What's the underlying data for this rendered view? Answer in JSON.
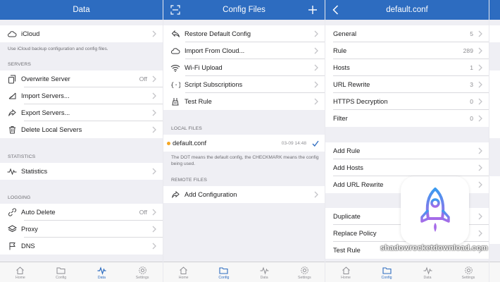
{
  "colors": {
    "nav": "#2d6cc0",
    "accent": "#2d6cc0",
    "dot": "#f5a623"
  },
  "data_panel": {
    "title": "Data",
    "icloud_label": "iCloud",
    "icloud_note": "Use iCloud backup configuration and config files.",
    "servers_header": "SERVERS",
    "overwrite_label": "Overwrite Server",
    "overwrite_value": "Off",
    "import_label": "Import Servers...",
    "export_label": "Export Servers...",
    "delete_label": "Delete Local Servers",
    "statistics_header": "STATISTICS",
    "statistics_label": "Statistics",
    "logging_header": "LOGGING",
    "auto_delete_label": "Auto Delete",
    "auto_delete_value": "Off",
    "proxy_label": "Proxy",
    "dns_label": "DNS"
  },
  "config_panel": {
    "title": "Config Files",
    "restore_label": "Restore Default Config",
    "import_cloud_label": "Import From Cloud...",
    "wifi_upload_label": "Wi-Fi Upload",
    "script_subs_label": "Script Subscriptions",
    "test_rule_label": "Test Rule",
    "local_header": "LOCAL FILES",
    "file_name": "default.conf",
    "file_date": "03-09 14:48",
    "file_note": "The DOT means the default config, the CHECKMARK means the config being used.",
    "remote_header": "REMOTE FILES",
    "add_config_label": "Add Configuration"
  },
  "conf_panel": {
    "title": "default.conf",
    "general_label": "General",
    "general_count": "5",
    "rule_label": "Rule",
    "rule_count": "289",
    "hosts_label": "Hosts",
    "hosts_count": "1",
    "url_rewrite_label": "URL Rewrite",
    "url_rewrite_count": "3",
    "https_label": "HTTPS Decryption",
    "https_count": "0",
    "filter_label": "Filter",
    "filter_count": "0",
    "add_rule_label": "Add Rule",
    "add_hosts_label": "Add Hosts",
    "add_url_rewrite_label": "Add URL Rewrite",
    "duplicate_label": "Duplicate",
    "replace_policy_label": "Replace Policy",
    "test_rule_label": "Test Rule"
  },
  "tabs": {
    "home": "Home",
    "config": "Config",
    "data": "Data",
    "settings": "Settings"
  },
  "watermark": "shadowrocketdownload.com",
  "icons": [
    "cloud-icon",
    "copy-icon",
    "import-icon",
    "export-icon",
    "trash-icon",
    "pulse-icon",
    "stack-icon",
    "flag-icon",
    "restore-icon",
    "wifi-icon",
    "script-icon",
    "test-icon",
    "scan-icon",
    "plus-icon",
    "back-icon",
    "rocket-icon"
  ]
}
